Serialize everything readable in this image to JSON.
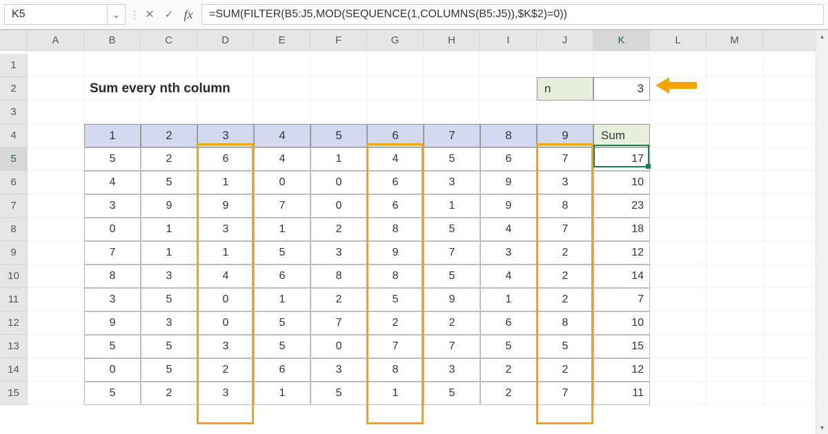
{
  "namebox": "K5",
  "formula": "=SUM(FILTER(B5:J5,MOD(SEQUENCE(1,COLUMNS(B5:J5)),$K$2)=0))",
  "title": "Sum every nth column",
  "n_label": "n",
  "n_value": "3",
  "columns": [
    "A",
    "B",
    "C",
    "D",
    "E",
    "F",
    "G",
    "H",
    "I",
    "J",
    "K",
    "L",
    "M"
  ],
  "rows": [
    "1",
    "2",
    "3",
    "4",
    "5",
    "6",
    "7",
    "8",
    "9",
    "10",
    "11",
    "12",
    "13",
    "14",
    "15"
  ],
  "active_col": "K",
  "active_row": "5",
  "headers_num": [
    "1",
    "2",
    "3",
    "4",
    "5",
    "6",
    "7",
    "8",
    "9"
  ],
  "sum_header": "Sum",
  "data": [
    [
      "5",
      "2",
      "6",
      "4",
      "1",
      "4",
      "5",
      "6",
      "7"
    ],
    [
      "4",
      "5",
      "1",
      "0",
      "0",
      "6",
      "3",
      "9",
      "3"
    ],
    [
      "3",
      "9",
      "9",
      "7",
      "0",
      "6",
      "1",
      "9",
      "8"
    ],
    [
      "0",
      "1",
      "3",
      "1",
      "2",
      "8",
      "5",
      "4",
      "7"
    ],
    [
      "7",
      "1",
      "1",
      "5",
      "3",
      "9",
      "7",
      "3",
      "2"
    ],
    [
      "8",
      "3",
      "4",
      "6",
      "8",
      "8",
      "5",
      "4",
      "2"
    ],
    [
      "3",
      "5",
      "0",
      "1",
      "2",
      "5",
      "9",
      "1",
      "2"
    ],
    [
      "9",
      "3",
      "0",
      "5",
      "7",
      "2",
      "2",
      "6",
      "8"
    ],
    [
      "5",
      "5",
      "3",
      "5",
      "0",
      "7",
      "7",
      "5",
      "5"
    ],
    [
      "0",
      "5",
      "2",
      "6",
      "3",
      "8",
      "3",
      "2",
      "2"
    ],
    [
      "5",
      "2",
      "3",
      "1",
      "5",
      "1",
      "5",
      "2",
      "7"
    ]
  ],
  "sums": [
    "17",
    "10",
    "23",
    "18",
    "12",
    "14",
    "7",
    "10",
    "15",
    "12",
    "11"
  ],
  "icons": {
    "dropdown": "⌄",
    "sep": "⋮",
    "cancel": "✕",
    "confirm": "✓",
    "up": "▴",
    "down": "▾"
  },
  "fx": "fx",
  "chart_data": {
    "type": "table",
    "title": "Sum every nth column",
    "n": 3,
    "columns": [
      "1",
      "2",
      "3",
      "4",
      "5",
      "6",
      "7",
      "8",
      "9",
      "Sum"
    ],
    "rows": [
      [
        5,
        2,
        6,
        4,
        1,
        4,
        5,
        6,
        7,
        17
      ],
      [
        4,
        5,
        1,
        0,
        0,
        6,
        3,
        9,
        3,
        10
      ],
      [
        3,
        9,
        9,
        7,
        0,
        6,
        1,
        9,
        8,
        23
      ],
      [
        0,
        1,
        3,
        1,
        2,
        8,
        5,
        4,
        7,
        18
      ],
      [
        7,
        1,
        1,
        5,
        3,
        9,
        7,
        3,
        2,
        12
      ],
      [
        8,
        3,
        4,
        6,
        8,
        8,
        5,
        4,
        2,
        14
      ],
      [
        3,
        5,
        0,
        1,
        2,
        5,
        9,
        1,
        2,
        7
      ],
      [
        9,
        3,
        0,
        5,
        7,
        2,
        2,
        6,
        8,
        10
      ],
      [
        5,
        5,
        3,
        5,
        0,
        7,
        7,
        5,
        5,
        15
      ],
      [
        0,
        5,
        2,
        6,
        3,
        8,
        3,
        2,
        2,
        12
      ],
      [
        5,
        2,
        3,
        1,
        5,
        1,
        5,
        2,
        7,
        11
      ]
    ]
  }
}
